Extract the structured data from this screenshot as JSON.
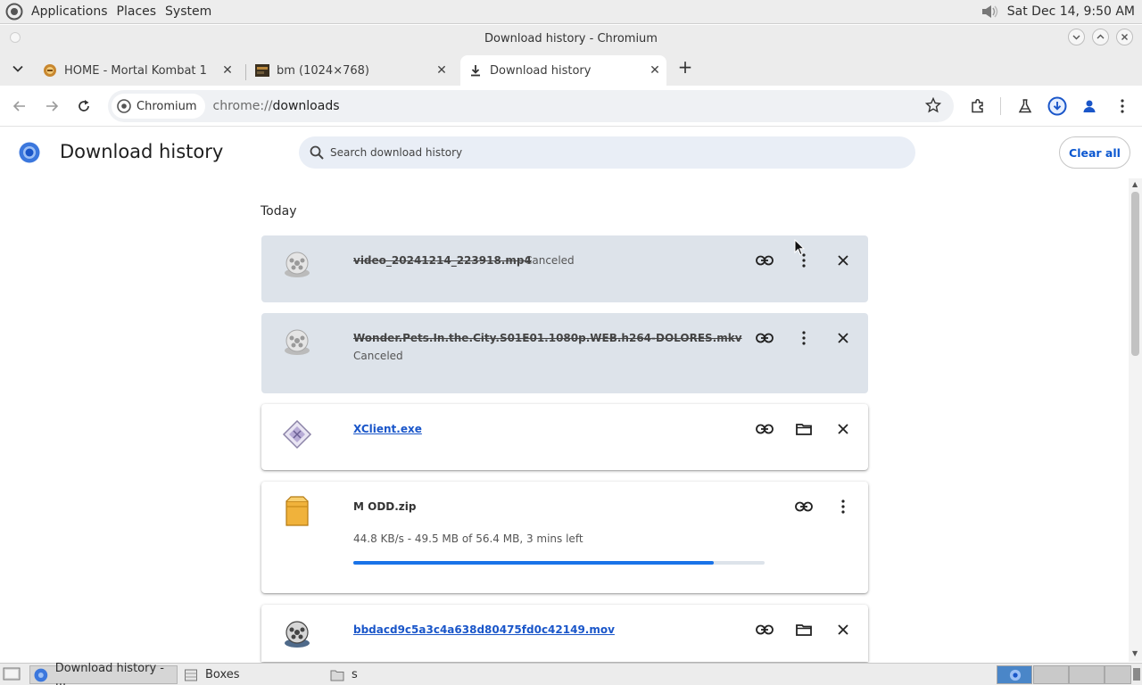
{
  "top_panel": {
    "menus": [
      "Applications",
      "Places",
      "System"
    ],
    "clock": "Sat Dec 14,  9:50 AM"
  },
  "window": {
    "title": "Download history - Chromium"
  },
  "tabs": [
    {
      "title": "HOME - Mortal Kombat 1",
      "icon": "mk-favicon"
    },
    {
      "title": "bm (1024×768)",
      "icon": "image-thumb-favicon"
    },
    {
      "title": "Download history",
      "icon": "download-icon",
      "active": true
    }
  ],
  "toolbar": {
    "chip_label": "Chromium",
    "url_scheme": "chrome://",
    "url_path": "downloads"
  },
  "page": {
    "title": "Download history",
    "search_placeholder": "Search download history",
    "clear_all": "Clear all",
    "section": "Today"
  },
  "downloads": [
    {
      "name": "video_20241214_223918.mp4",
      "status": "Canceled",
      "state": "canceled",
      "icon": "film-reel-icon"
    },
    {
      "name": "Wonder.Pets.In.the.City.S01E01.1080p.WEB.h264-DOLORES.mkv",
      "status": "Canceled",
      "state": "canceled",
      "icon": "film-reel-icon"
    },
    {
      "name": "XClient.exe",
      "state": "complete",
      "icon": "executable-icon"
    },
    {
      "name": "M ODD.zip",
      "status": "44.8 KB/s - 49.5 MB of 56.4 MB, 3 mins left",
      "state": "in-progress",
      "progress": 0.877,
      "icon": "archive-icon"
    },
    {
      "name": "bbdacd9c5a3c4a638d80475fd0c42149.mov",
      "state": "complete",
      "icon": "film-reel-icon"
    }
  ],
  "taskbar": [
    {
      "label": "Download history - ...",
      "active": true
    },
    {
      "label": "Boxes"
    },
    {
      "label": "s"
    }
  ],
  "colors": {
    "accent": "#0b57d0",
    "progress": "#1a73e8",
    "canceled_card": "#dde3ea"
  }
}
